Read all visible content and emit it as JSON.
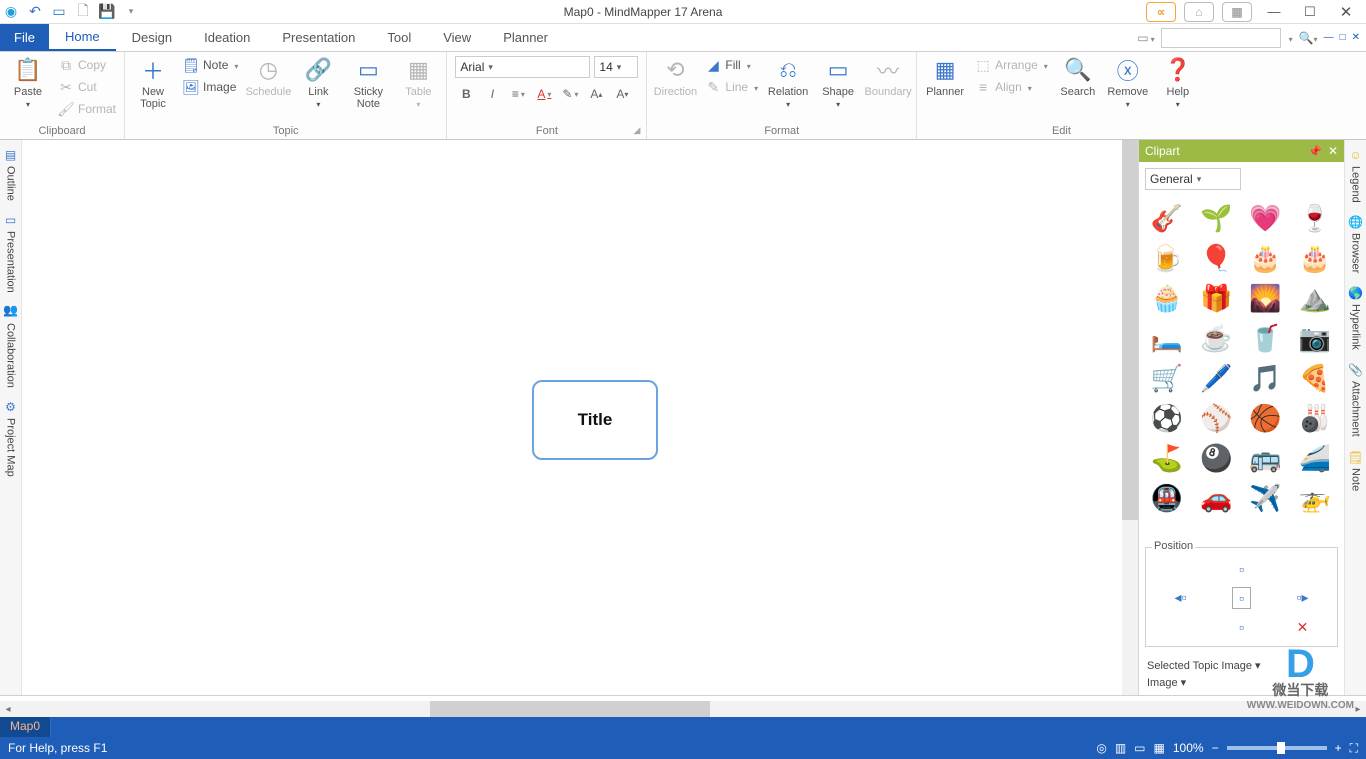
{
  "title": "Map0 - MindMapper 17 Arena",
  "menu": {
    "file": "File",
    "tabs": [
      "Home",
      "Design",
      "Ideation",
      "Presentation",
      "Tool",
      "View",
      "Planner"
    ],
    "active": 0
  },
  "ribbon": {
    "clipboard": {
      "label": "Clipboard",
      "paste": "Paste",
      "copy": "Copy",
      "cut": "Cut",
      "format": "Format"
    },
    "topic": {
      "label": "Topic",
      "newTopic": "New\nTopic",
      "note": "Note",
      "image": "Image",
      "schedule": "Schedule",
      "link": "Link",
      "sticky": "Sticky\nNote",
      "table": "Table"
    },
    "font": {
      "label": "Font",
      "name": "Arial",
      "size": "14"
    },
    "format": {
      "label": "Format",
      "direction": "Direction",
      "fill": "Fill",
      "line": "Line",
      "relation": "Relation",
      "shape": "Shape",
      "boundary": "Boundary"
    },
    "edit": {
      "label": "Edit",
      "planner": "Planner",
      "arrange": "Arrange",
      "align": "Align",
      "search": "Search",
      "remove": "Remove",
      "help": "Help"
    }
  },
  "leftRail": [
    "Outline",
    "Presentation",
    "Collaboration",
    "Project Map"
  ],
  "rightRail": [
    "Legend",
    "Browser",
    "Hyperlink",
    "Attachment",
    "Note"
  ],
  "canvas": {
    "nodeText": "Title"
  },
  "clipart": {
    "header": "Clipart",
    "category": "General",
    "items": [
      {
        "e": "🎸",
        "n": "guitar"
      },
      {
        "e": "🌱",
        "n": "plant"
      },
      {
        "e": "💗",
        "n": "heart"
      },
      {
        "e": "🍷",
        "n": "wine"
      },
      {
        "e": "🍺",
        "n": "beer"
      },
      {
        "e": "🎈",
        "n": "balloon"
      },
      {
        "e": "🎂",
        "n": "cake"
      },
      {
        "e": "🎂",
        "n": "cake2"
      },
      {
        "e": "🧁",
        "n": "cupcake"
      },
      {
        "e": "🎁",
        "n": "gift"
      },
      {
        "e": "🌄",
        "n": "sunrise"
      },
      {
        "e": "⛰️",
        "n": "mountain"
      },
      {
        "e": "🛏️",
        "n": "bed"
      },
      {
        "e": "☕",
        "n": "coffee"
      },
      {
        "e": "🥤",
        "n": "drink"
      },
      {
        "e": "📷",
        "n": "camera"
      },
      {
        "e": "🛒",
        "n": "cart"
      },
      {
        "e": "🖊️",
        "n": "pen"
      },
      {
        "e": "🎵",
        "n": "music"
      },
      {
        "e": "🍕",
        "n": "pizza"
      },
      {
        "e": "⚽",
        "n": "soccer"
      },
      {
        "e": "⚾",
        "n": "baseball"
      },
      {
        "e": "🏀",
        "n": "basketball"
      },
      {
        "e": "🎳",
        "n": "bowling"
      },
      {
        "e": "⛳",
        "n": "golf"
      },
      {
        "e": "🎱",
        "n": "pool"
      },
      {
        "e": "🚌",
        "n": "bus"
      },
      {
        "e": "🚄",
        "n": "train"
      },
      {
        "e": "🚇",
        "n": "metro"
      },
      {
        "e": "🚗",
        "n": "car"
      },
      {
        "e": "✈️",
        "n": "plane"
      },
      {
        "e": "🚁",
        "n": "helicopter"
      }
    ],
    "position": "Position",
    "selectedTopicImage": "Selected Topic Image",
    "image": "Image"
  },
  "docTabs": [
    "Map0"
  ],
  "status": {
    "help": "For Help, press F1",
    "zoom": "100%"
  },
  "watermark": {
    "l1": "微当下载",
    "l2": "WWW.WEIDOWN.COM"
  }
}
